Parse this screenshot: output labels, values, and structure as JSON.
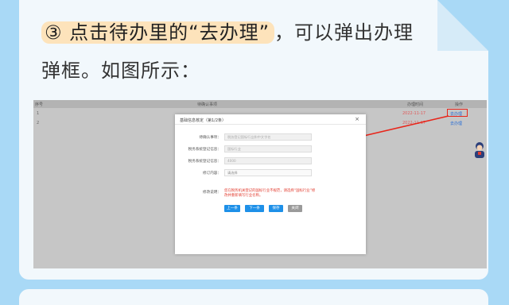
{
  "instruction": {
    "highlight": "③ 点击待办里的“去办理”",
    "line1_rest": "，可以弹出办理",
    "line2": "弹框。如图所示："
  },
  "table": {
    "headers": [
      "序号",
      "待确认事项",
      "办理时间",
      "操作"
    ],
    "rows": [
      {
        "index": "1",
        "date": "2022-11-17",
        "action": "去办理"
      },
      {
        "index": "2",
        "date": "2022-11-17",
        "action": "去办理"
      }
    ]
  },
  "modal": {
    "title": "基础信息核定（第1/2条）",
    "close": "×",
    "fields": [
      {
        "label": "待确认事项：",
        "value": "税务登记国标行业和中文字名"
      },
      {
        "label": "税务系统登记信息：",
        "value": "国标行业"
      },
      {
        "label": "税务系统登记信息：",
        "value": "4000"
      },
      {
        "label": "修订内容：",
        "value": "请选择"
      }
    ],
    "note_label": "修改说明：",
    "note": "您在税务机关登记的国标行业不规范，请选择“国标行业”修改并重新填写行业名称。",
    "buttons": {
      "prev": "上一条",
      "next": "下一条",
      "save": "保存",
      "close": "关闭"
    }
  },
  "colors": {
    "page_bg": "#a9d9f6",
    "highlight": "#fde3bb",
    "annotation_red": "#e8261b",
    "button_blue": "#1e90e8"
  }
}
